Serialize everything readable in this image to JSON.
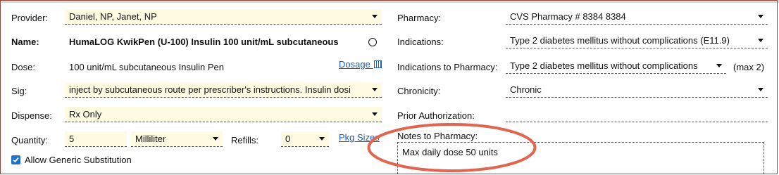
{
  "left": {
    "provider_label": "Provider:",
    "provider_value": "Daniel, NP, Janet, NP",
    "name_label": "Name:",
    "name_value": "HumaLOG KwikPen (U-100) Insulin 100 unit/mL subcutaneous",
    "dose_label": "Dose:",
    "dose_value": "100 unit/mL subcutaneous Insulin Pen",
    "dosage_link": "Dosage",
    "sig_label": "Sig:",
    "sig_value": "inject by subcutaneous route per prescriber's instructions. Insulin dosi",
    "dispense_label": "Dispense:",
    "dispense_value": "Rx Only",
    "quantity_label": "Quantity:",
    "quantity_value": "5",
    "unit_value": "Milliliter",
    "refills_label": "Refills:",
    "refills_value": "0",
    "pkg_link": "Pkg Sizes",
    "generic_label": "Allow Generic Substitution"
  },
  "right": {
    "pharmacy_label": "Pharmacy:",
    "pharmacy_value": "CVS Pharmacy # 8384 8384",
    "indications_label": "Indications:",
    "indications_value": "Type 2 diabetes mellitus without complications (E11.9)",
    "ind_pharm_label": "Indications to Pharmacy:",
    "ind_pharm_value": "Type 2 diabetes mellitus without complications",
    "max_label": "(max 2)",
    "chronicity_label": "Chronicity:",
    "chronicity_value": "Chronic",
    "prior_auth_label": "Prior Authorization:",
    "notes_label": "Notes to Pharmacy:",
    "notes_value": "Max daily dose 50 units"
  },
  "colors": {
    "field_bg": "#fffbe3",
    "link": "#1a5fb4",
    "highlight_oval": "#e0664f",
    "checkbox": "#1f6fd1"
  }
}
